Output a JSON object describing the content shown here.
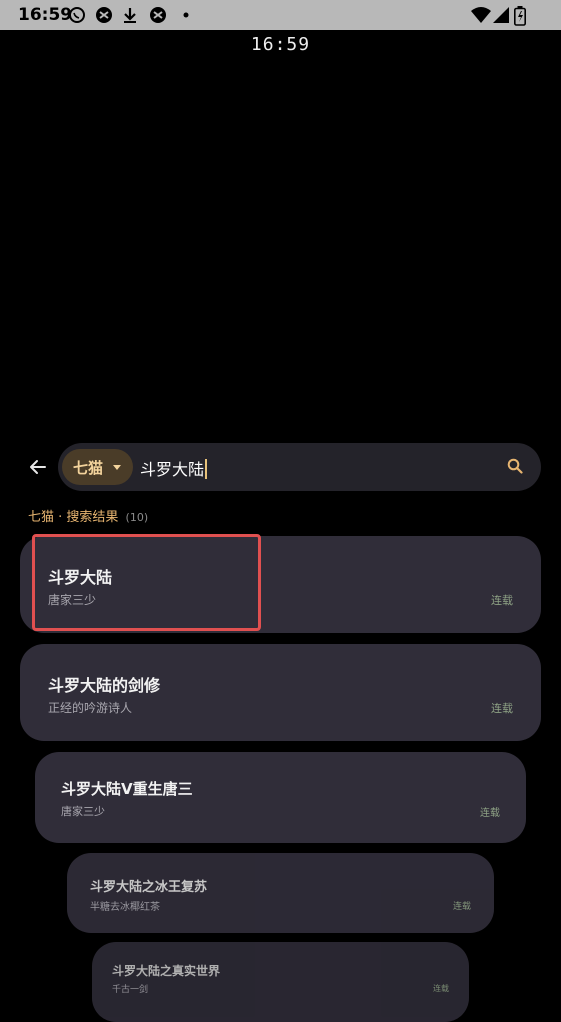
{
  "status_bar": {
    "time": "16:59",
    "icons": [
      "whatsapp-icon",
      "app-icon",
      "download-icon",
      "app-icon",
      "dot-icon",
      "wifi-icon",
      "signal-icon",
      "battery-icon"
    ]
  },
  "clock": "16:59",
  "search": {
    "source": "七猫",
    "query": "斗罗大陆"
  },
  "results_header": {
    "label": "七猫 · 搜索结果",
    "count": "(10)"
  },
  "results": [
    {
      "title": "斗罗大陆",
      "author": "唐家三少",
      "status": "连载"
    },
    {
      "title": "斗罗大陆的剑修",
      "author": "正经的吟游诗人",
      "status": "连载"
    },
    {
      "title": "斗罗大陆V重生唐三",
      "author": "唐家三少",
      "status": "连载"
    },
    {
      "title": "斗罗大陆之冰王复苏",
      "author": "半糖去冰椰红茶",
      "status": "连载"
    },
    {
      "title": "斗罗大陆之真实世界",
      "author": "千古一剑",
      "status": "连载"
    }
  ],
  "colors": {
    "background": "#000000",
    "card": "#302d39",
    "accent": "#e7b571",
    "status": "#8ea285",
    "highlight": "#e05050"
  }
}
